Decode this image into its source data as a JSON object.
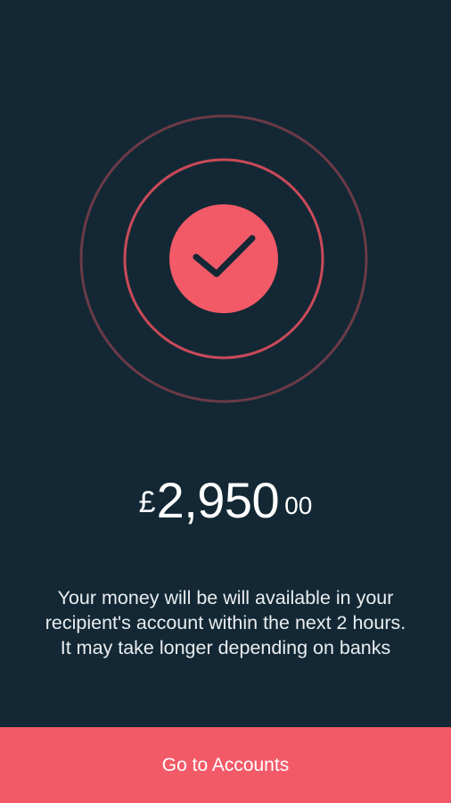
{
  "success": {
    "icon": "check-circle-icon",
    "accent_color": "#f35a68",
    "background_color": "#132834"
  },
  "amount": {
    "currency": "£",
    "whole": "2,950",
    "fraction": "00"
  },
  "message": {
    "line1": "Your money will be will available in your",
    "line2": "recipient's account within the next 2 hours.",
    "line3": "It may take longer depending on banks"
  },
  "cta": {
    "label": "Go to Accounts"
  }
}
